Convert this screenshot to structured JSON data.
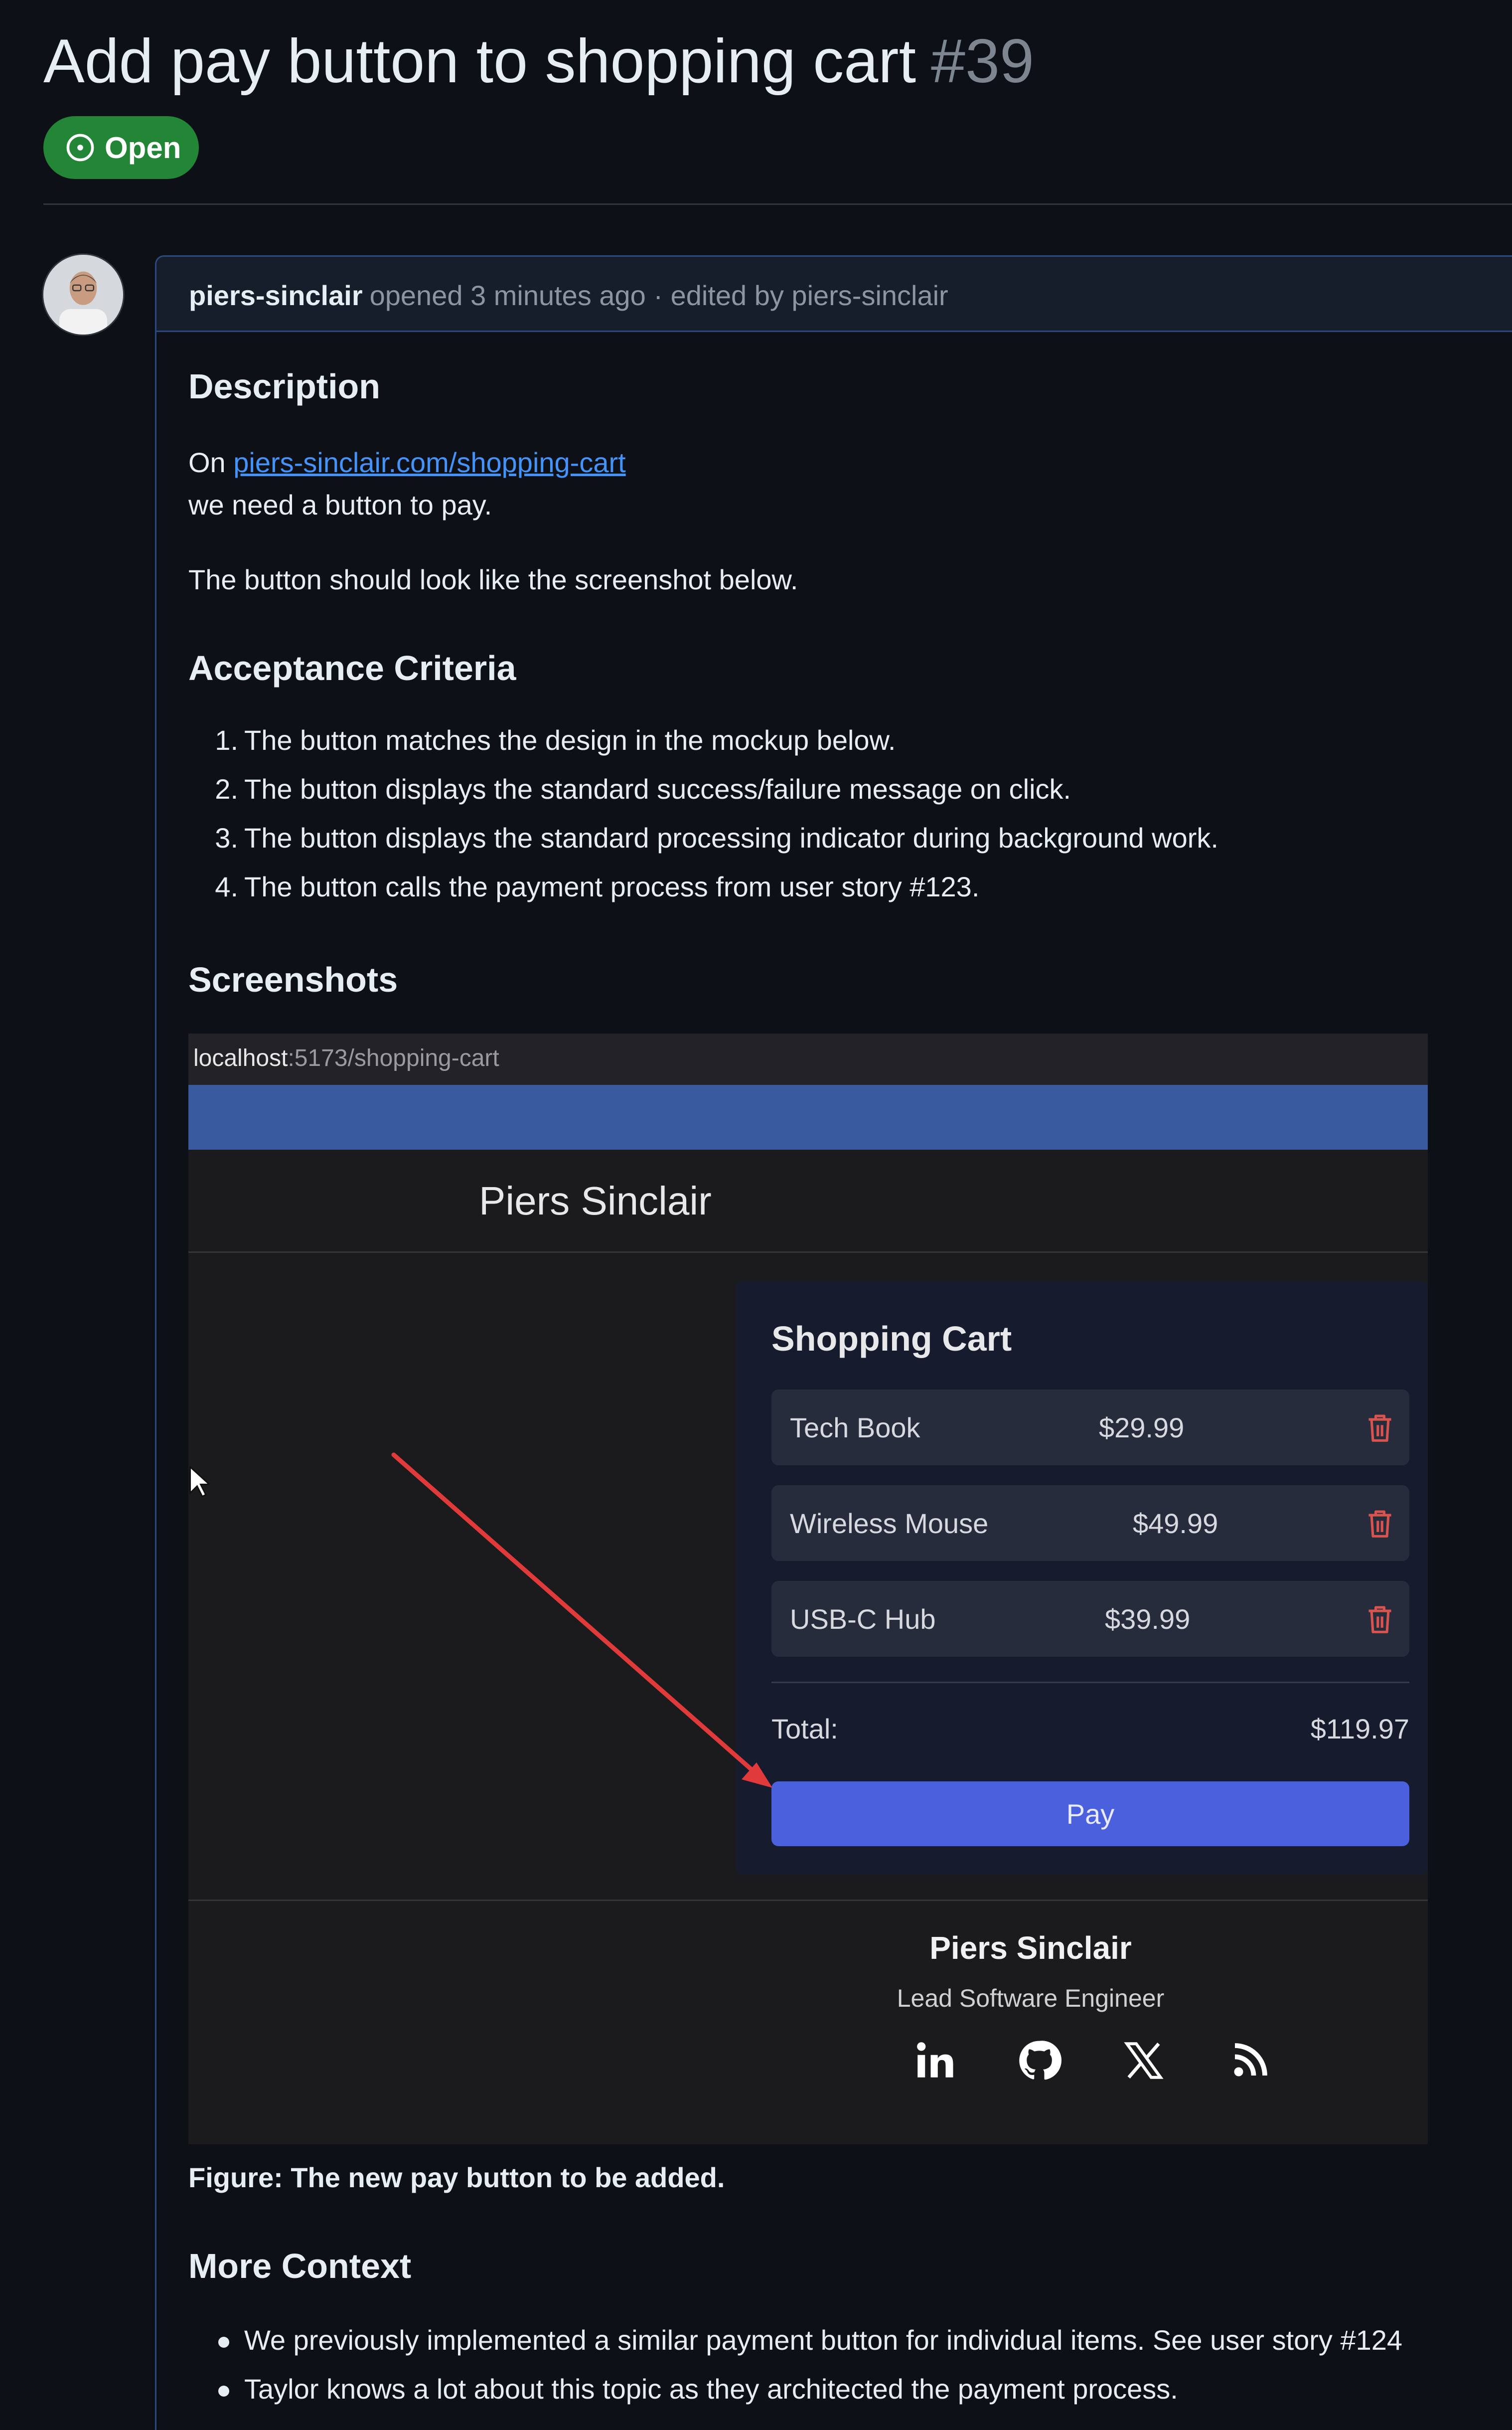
{
  "issue": {
    "title": "Add pay button to shopping cart",
    "number": "#39",
    "status": "Open"
  },
  "comment": {
    "author": "piers-sinclair",
    "meta": "opened 3 minutes ago · edited by piers-sinclair",
    "description_heading": "Description",
    "desc_prefix": "On",
    "desc_link": "piers-sinclair.com/shopping-cart",
    "desc_line2": "we need a button to pay.",
    "desc_line3": "The button should look like the screenshot below.",
    "acceptance_heading": "Acceptance Criteria",
    "criteria": [
      "The button matches the design in the mockup below.",
      "The button displays the standard success/failure message on click.",
      "The button displays the standard processing indicator during background work.",
      "The button calls the payment process from user story #123."
    ],
    "screenshots_heading": "Screenshots",
    "caption": "Figure: The new pay button to be added.",
    "context_heading": "More Context",
    "context": [
      "We previously implemented a similar payment button for individual items. See user story #124",
      "Taylor knows a lot about this topic as they architected the payment process."
    ]
  },
  "screenshot": {
    "url_host": "localhost",
    "url_rest": ":5173/shopping-cart",
    "site_name": "Piers Sinclair",
    "cart_title": "Shopping Cart",
    "items": [
      {
        "name": "Tech Book",
        "price": "$29.99"
      },
      {
        "name": "Wireless Mouse",
        "price": "$49.99"
      },
      {
        "name": "USB-C Hub",
        "price": "$39.99"
      }
    ],
    "total_label": "Total:",
    "total_value": "$119.97",
    "pay_label": "Pay",
    "footer_name": "Piers Sinclair",
    "footer_role": "Lead Software Engineer",
    "social_icons": [
      "linkedin-icon",
      "github-icon",
      "x-icon",
      "rss-icon"
    ]
  },
  "colors": {
    "background": "#0d1117",
    "open_badge": "#238636",
    "link": "#4493f8",
    "pay_button": "#4b60dc",
    "arrow": "#e03a3a",
    "trash": "#d9534f"
  }
}
